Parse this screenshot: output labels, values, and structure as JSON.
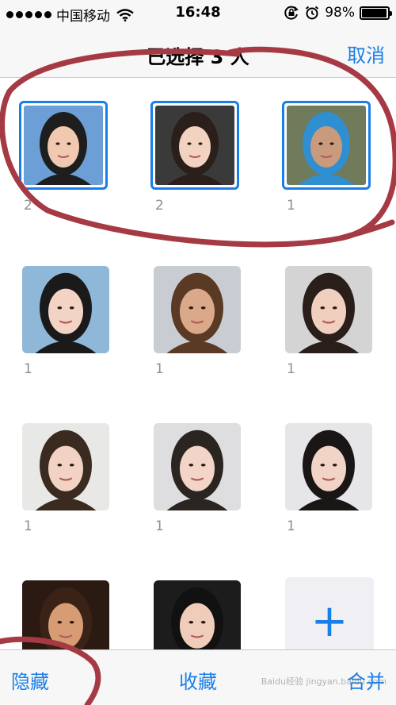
{
  "status_bar": {
    "carrier": "中国移动",
    "time": "16:48",
    "battery_percent": "98%",
    "battery_level": 0.98,
    "icons": [
      "wifi-icon",
      "orientation-lock-icon",
      "alarm-icon",
      "battery-icon"
    ]
  },
  "nav": {
    "title": "已选择 3 人",
    "cancel_label": "取消"
  },
  "people": [
    {
      "count": "2",
      "selected": true,
      "tones": [
        "#6b9fd6",
        "#f0c9b0",
        "#1e1e1e"
      ]
    },
    {
      "count": "2",
      "selected": true,
      "tones": [
        "#3a3a3a",
        "#f2d2c0",
        "#2a1f1a"
      ]
    },
    {
      "count": "1",
      "selected": true,
      "tones": [
        "#6f7b5a",
        "#c99b7c",
        "#2f8fd0"
      ]
    },
    {
      "count": "1",
      "selected": false,
      "tones": [
        "#8fb8d8",
        "#f3d3c3",
        "#1a1a1a"
      ]
    },
    {
      "count": "1",
      "selected": false,
      "tones": [
        "#c9cdd3",
        "#d9a98a",
        "#5a3a25"
      ]
    },
    {
      "count": "1",
      "selected": false,
      "tones": [
        "#d4d4d4",
        "#f0cfbf",
        "#2a1e1a"
      ]
    },
    {
      "count": "1",
      "selected": false,
      "tones": [
        "#e8e8e6",
        "#f1d2c3",
        "#3a2a20"
      ]
    },
    {
      "count": "1",
      "selected": false,
      "tones": [
        "#dedee0",
        "#f2d5c6",
        "#2b2522"
      ]
    },
    {
      "count": "1",
      "selected": false,
      "tones": [
        "#e6e6e8",
        "#f1d4c6",
        "#1b1616"
      ]
    },
    {
      "count": "",
      "selected": false,
      "tones": [
        "#2b1a12",
        "#d79c74",
        "#3a2216"
      ]
    },
    {
      "count": "",
      "selected": false,
      "tones": [
        "#1c1c1c",
        "#f0cdbb",
        "#111111"
      ]
    }
  ],
  "add_tile": {
    "symbol": "+"
  },
  "toolbar": {
    "hide_label": "隐藏",
    "favorite_label": "收藏",
    "merge_label": "合并"
  },
  "watermark": "Baidu经验 jingyan.baidu.com",
  "colors": {
    "accent": "#1a7ee8",
    "annotation": "#a63a44",
    "bar_background": "#f7f7f7",
    "secondary_text": "#8e8e93"
  }
}
